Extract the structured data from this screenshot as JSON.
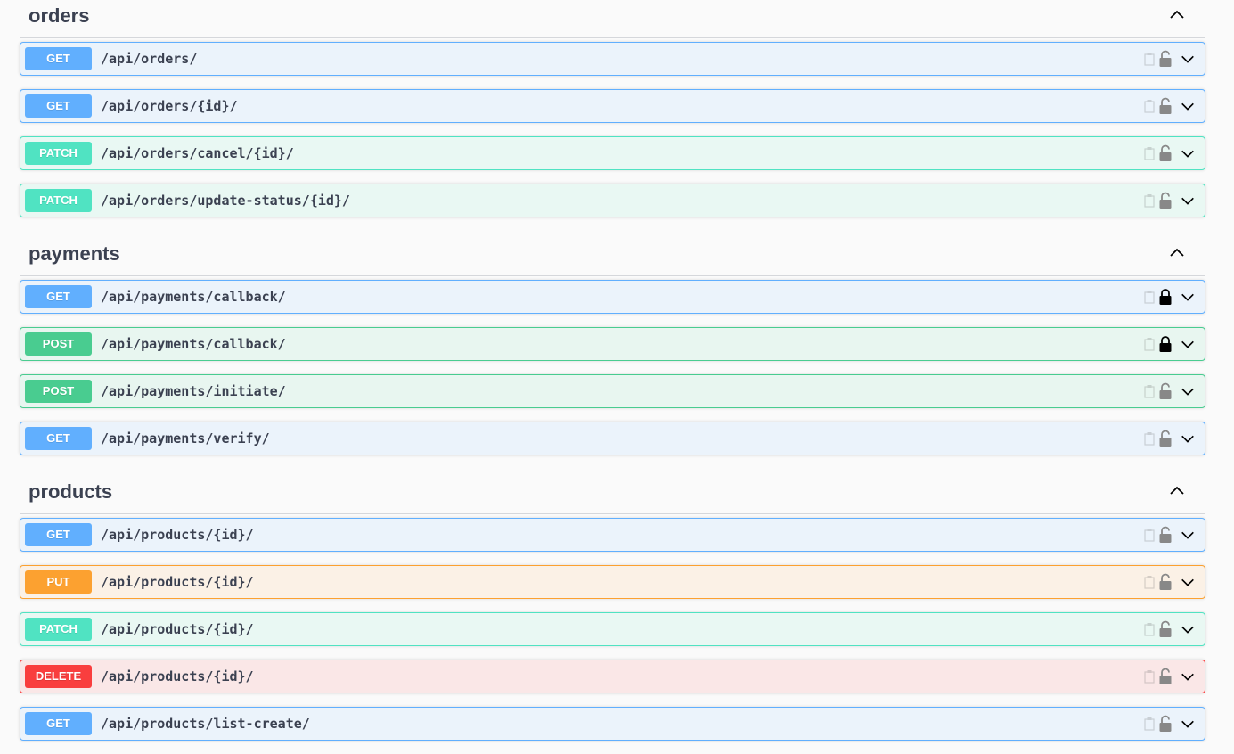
{
  "sections": [
    {
      "title": "orders",
      "endpoints": [
        {
          "method": "GET",
          "path": "/api/orders/",
          "locked": false
        },
        {
          "method": "GET",
          "path": "/api/orders/{id}/",
          "locked": false
        },
        {
          "method": "PATCH",
          "path": "/api/orders/cancel/{id}/",
          "locked": false
        },
        {
          "method": "PATCH",
          "path": "/api/orders/update-status/{id}/",
          "locked": false
        }
      ]
    },
    {
      "title": "payments",
      "endpoints": [
        {
          "method": "GET",
          "path": "/api/payments/callback/",
          "locked": true
        },
        {
          "method": "POST",
          "path": "/api/payments/callback/",
          "locked": true
        },
        {
          "method": "POST",
          "path": "/api/payments/initiate/",
          "locked": false
        },
        {
          "method": "GET",
          "path": "/api/payments/verify/",
          "locked": false
        }
      ]
    },
    {
      "title": "products",
      "endpoints": [
        {
          "method": "GET",
          "path": "/api/products/{id}/",
          "locked": false
        },
        {
          "method": "PUT",
          "path": "/api/products/{id}/",
          "locked": false
        },
        {
          "method": "PATCH",
          "path": "/api/products/{id}/",
          "locked": false
        },
        {
          "method": "DELETE",
          "path": "/api/products/{id}/",
          "locked": false
        },
        {
          "method": "GET",
          "path": "/api/products/list-create/",
          "locked": false
        }
      ]
    }
  ],
  "icons": {
    "section_toggle": "chevron-up-icon",
    "row_toggle": "chevron-down-icon",
    "copy": "copy-icon",
    "lock_unlocked": "lock-open-icon",
    "lock_locked": "lock-closed-icon"
  },
  "colors": {
    "get": "#61affe",
    "post": "#49cc90",
    "put": "#fca130",
    "patch": "#50e3c2",
    "delete": "#f93e3e",
    "lock_unlocked": "#888888",
    "lock_locked": "#000000"
  }
}
